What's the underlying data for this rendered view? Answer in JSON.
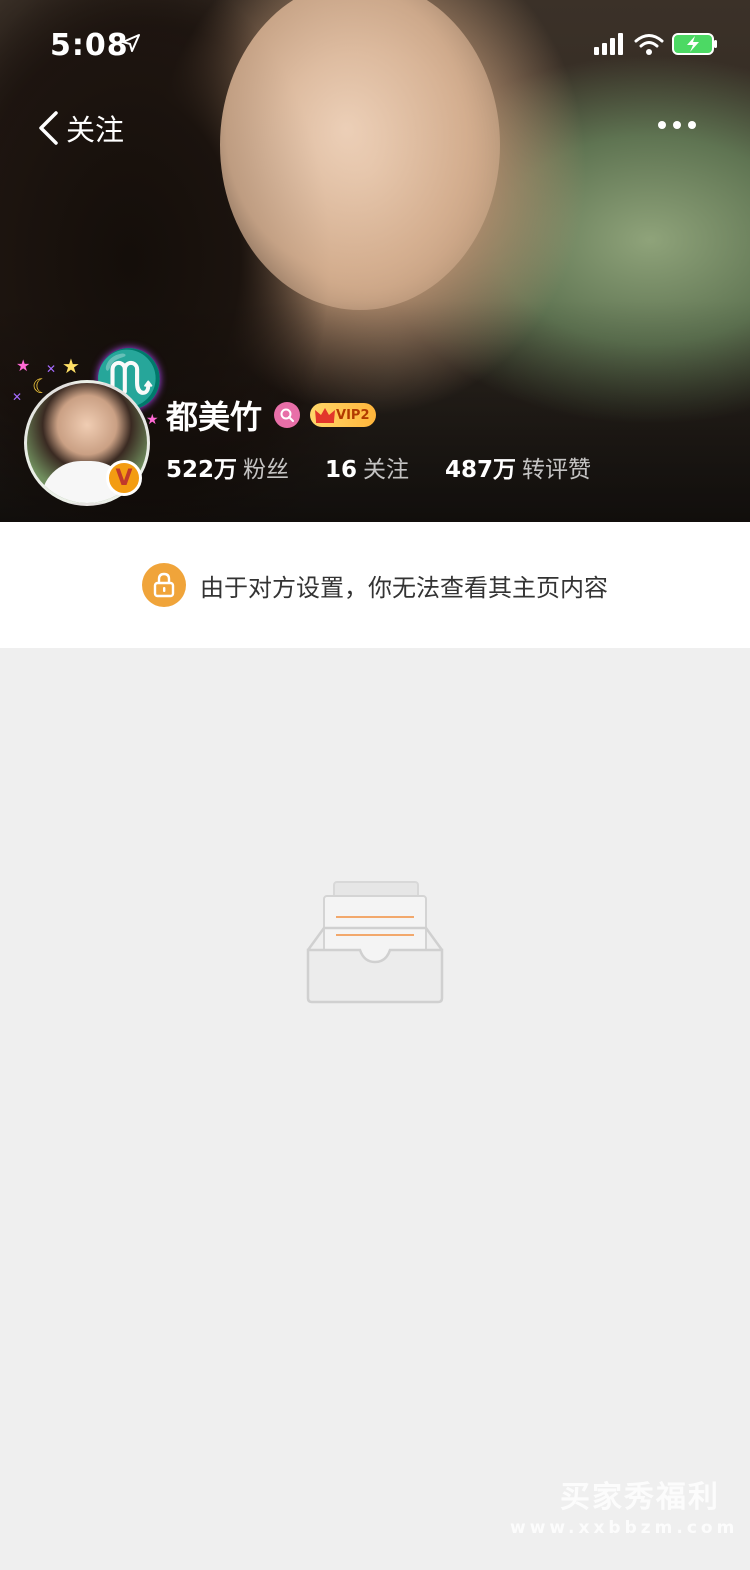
{
  "status_bar": {
    "time": "5:08"
  },
  "nav": {
    "back_label": "关注"
  },
  "profile": {
    "name": "都美竹",
    "vip_label": "VIP2",
    "avatar_badge": "V",
    "stats": [
      {
        "num": "522万",
        "label": "粉丝"
      },
      {
        "num": "16",
        "label": "关注"
      },
      {
        "num": "487万",
        "label": "转评赞"
      }
    ]
  },
  "notice": {
    "text": "由于对方设置，你无法查看其主页内容"
  },
  "watermark": {
    "line1": "买家秀福利",
    "line2": "www.xxbbzm.com"
  },
  "colors": {
    "lock_accent": "#f0a43a",
    "vip_gold": "#ffc24a",
    "pink_badge": "#e86fa8"
  }
}
